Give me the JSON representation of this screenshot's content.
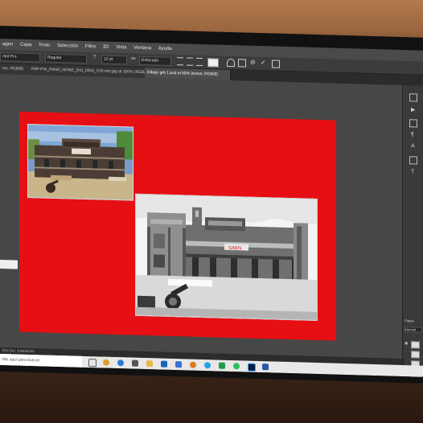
{
  "menu": {
    "items": [
      "agen",
      "Capa",
      "Texto",
      "Selección",
      "Filtro",
      "3D",
      "Vista",
      "Ventana",
      "Ayuda"
    ]
  },
  "options": {
    "font_family": "ried Pro",
    "font_style": "Regular",
    "font_size": "12 pt",
    "antialias": "Enfocado"
  },
  "tabs": [
    {
      "label": "ms, RGB/8)"
    },
    {
      "label": "PAP-FW_PANO_NONE_DIU_0915_010-min.jpg al 100% (RGB/8#)"
    },
    {
      "label": "Dibujo grb 1.psd al 50% (tonos, RGB/8)"
    }
  ],
  "drawing": {
    "sign_text": "SAEN"
  },
  "right_panel": {
    "layers_label": "Capas",
    "blend_mode": "Normal"
  },
  "status": {
    "text": "50% Doc: 8,5M/80,0M"
  },
  "taskbar": {
    "search_placeholder": "ribe aquí para buscar"
  }
}
